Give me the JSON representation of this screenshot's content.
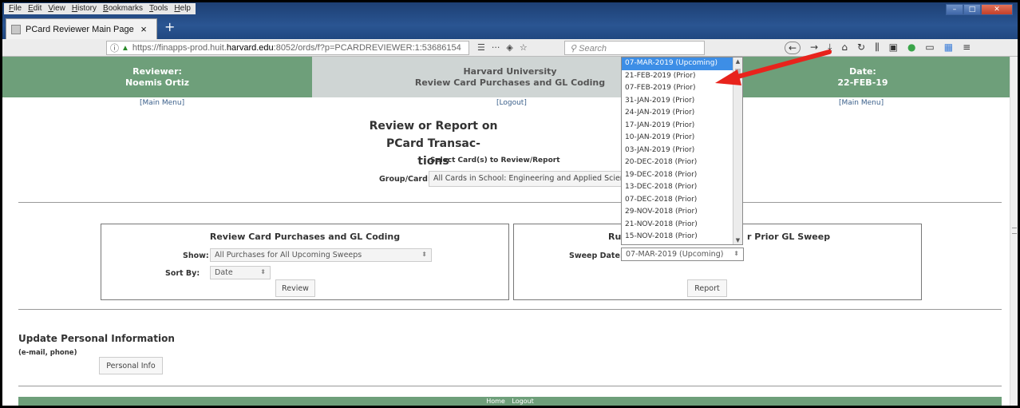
{
  "browser": {
    "menu": [
      "File",
      "Edit",
      "View",
      "History",
      "Bookmarks",
      "Tools",
      "Help"
    ],
    "tab_title": "PCard Reviewer Main Page",
    "tab_close": "×",
    "new_tab": "+",
    "url_plain": "https://finapps-prod.huit.",
    "url_domain": "harvard.edu",
    "url_rest": ":8052/ords/f?p=PCARDREVIEWER:1:53686154",
    "search_placeholder": "Search",
    "url_actions": [
      "☰",
      "···",
      "◈",
      "☆"
    ],
    "toolbar_icons": [
      "→",
      "⤓",
      "⌂",
      "↻",
      "⫼",
      "▣",
      "●",
      "▭",
      "▦",
      "≡"
    ]
  },
  "header": {
    "reviewer_label": "Reviewer:",
    "reviewer_name": "Noemis Ortiz",
    "org": "Harvard University",
    "subtitle": "Review Card Purchases and GL Coding",
    "date_label": "Date:",
    "date_value": "22-FEB-19"
  },
  "links": {
    "main_menu_left": "[Main Menu]",
    "logout": "[Logout]",
    "main_menu_right": "[Main Menu]"
  },
  "main": {
    "heading_line1": "Review or Report on PCard Transac-",
    "heading_line2": "tions",
    "select_cards_label": "Select Card(s) to Review/Report",
    "group_card_label": "Group/Card:",
    "group_card_value": "All Cards in School: Engineering and Applied Science"
  },
  "review_panel": {
    "title": "Review Card Purchases and GL Coding",
    "show_label": "Show:",
    "show_value": "All Purchases for All Upcoming Sweeps",
    "sort_label": "Sort By:",
    "sort_value": "Date",
    "button": "Review"
  },
  "report_panel": {
    "title_left": "Ru",
    "title_right": "r Prior GL Sweep",
    "sweep_label": "Sweep Date:",
    "sweep_value": "07-MAR-2019 (Upcoming)",
    "button": "Report"
  },
  "sweep_dropdown": {
    "options": [
      "07-MAR-2019 (Upcoming)",
      "21-FEB-2019 (Prior)",
      "07-FEB-2019 (Prior)",
      "31-JAN-2019 (Prior)",
      "24-JAN-2019 (Prior)",
      "17-JAN-2019 (Prior)",
      "10-JAN-2019 (Prior)",
      "03-JAN-2019 (Prior)",
      "20-DEC-2018 (Prior)",
      "19-DEC-2018 (Prior)",
      "13-DEC-2018 (Prior)",
      "07-DEC-2018 (Prior)",
      "29-NOV-2018 (Prior)",
      "21-NOV-2018 (Prior)",
      "15-NOV-2018 (Prior)"
    ],
    "selected_index": 0
  },
  "personal": {
    "title": "Update Personal Information",
    "subtitle": "(e-mail, phone)",
    "button": "Personal Info"
  },
  "footer": {
    "home": "Home",
    "logout": "Logout"
  },
  "colors": {
    "header_green": "#6e9f7a",
    "header_grey": "#cfd5d4",
    "selection_blue": "#3d8ee6",
    "annotation_red": "#e8231c"
  }
}
